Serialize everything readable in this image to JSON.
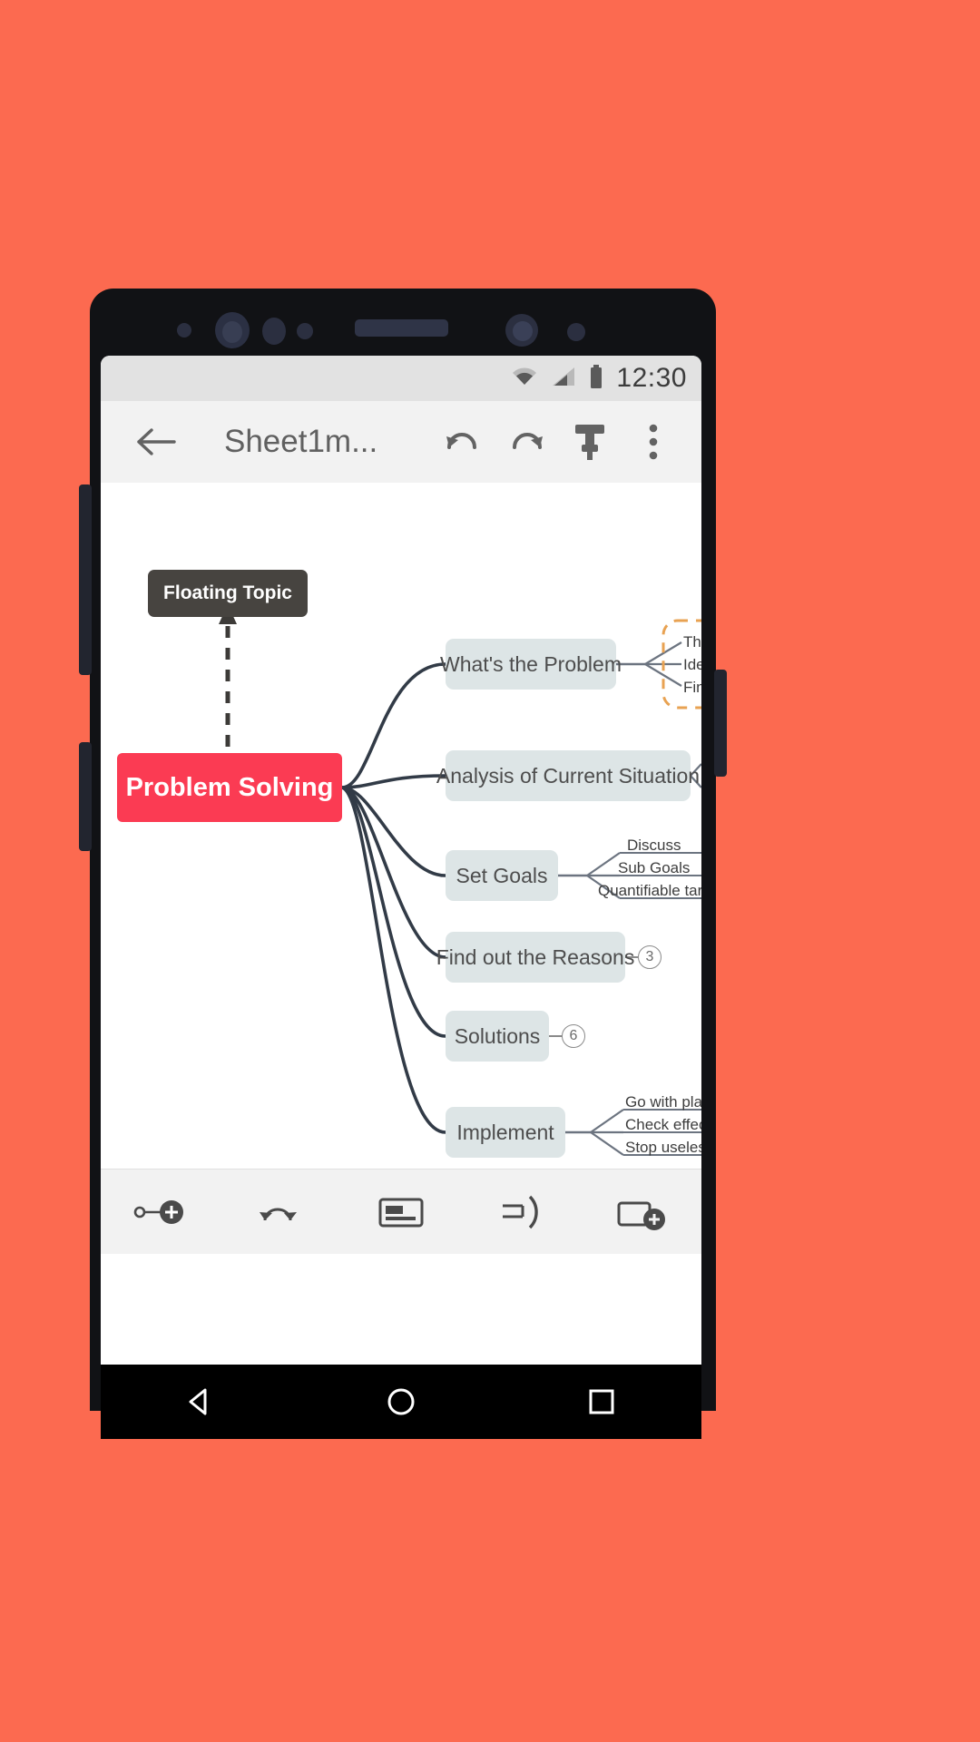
{
  "background_color": "#FC6A50",
  "status_bar": {
    "time": "12:30",
    "icons": [
      "wifi-icon",
      "cellular-signal-icon",
      "battery-icon"
    ]
  },
  "toolbar": {
    "back_icon": "back-arrow-icon",
    "title": "Sheet1m...",
    "undo_icon": "undo-icon",
    "redo_icon": "redo-icon",
    "format_icon": "format-brush-icon",
    "overflow_icon": "more-vertical-icon"
  },
  "mindmap": {
    "central_topic": "Problem Solving",
    "floating_topic": "Floating Topic",
    "branches": [
      {
        "label": "What's the Problem",
        "badge": null,
        "children": [
          "Th",
          "Ide",
          "Fin"
        ],
        "boundary": true
      },
      {
        "label": "Analysis of Current Situation",
        "badge": null,
        "children": []
      },
      {
        "label": "Set Goals",
        "badge": null,
        "children": [
          "Discuss",
          "Sub Goals",
          "Quantifiable targe"
        ]
      },
      {
        "label": "Find out the Reasons",
        "badge": "3",
        "children": []
      },
      {
        "label": "Solutions",
        "badge": "6",
        "children": []
      },
      {
        "label": "Implement",
        "badge": null,
        "children": [
          "Go with plans",
          "Check effect of",
          "Stop useless so"
        ]
      }
    ],
    "colors": {
      "central": "#FB3B53",
      "sub_node": "#dde5e6",
      "floating": "#474440",
      "line": "#323b47",
      "boundary": "#e8a252"
    }
  },
  "bottom_toolbar": {
    "items": [
      {
        "name": "add-subtopic-icon"
      },
      {
        "name": "add-relationship-icon"
      },
      {
        "name": "insert-image-icon"
      },
      {
        "name": "add-boundary-icon"
      },
      {
        "name": "add-floating-topic-icon"
      }
    ]
  },
  "nav_bar": {
    "back": "nav-back-triangle-icon",
    "home": "nav-home-circle-icon",
    "recents": "nav-recents-square-icon"
  }
}
